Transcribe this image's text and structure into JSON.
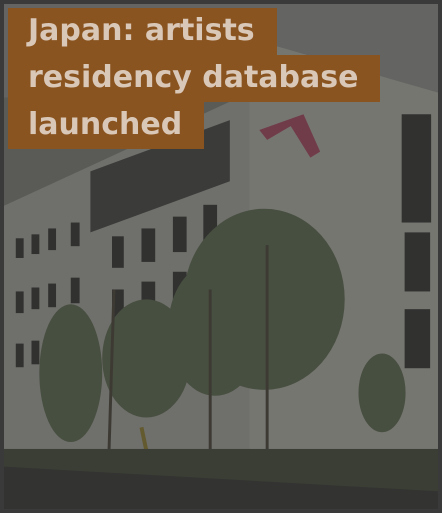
{
  "article": {
    "headline_lines": [
      "Japan: artists",
      "residency database",
      "launched"
    ]
  },
  "colors": {
    "headline_bg": "#8a5420",
    "headline_text": "#d9c7b8",
    "photo_overlay": "#3b3b39"
  },
  "image": {
    "subject": "building-photo"
  }
}
